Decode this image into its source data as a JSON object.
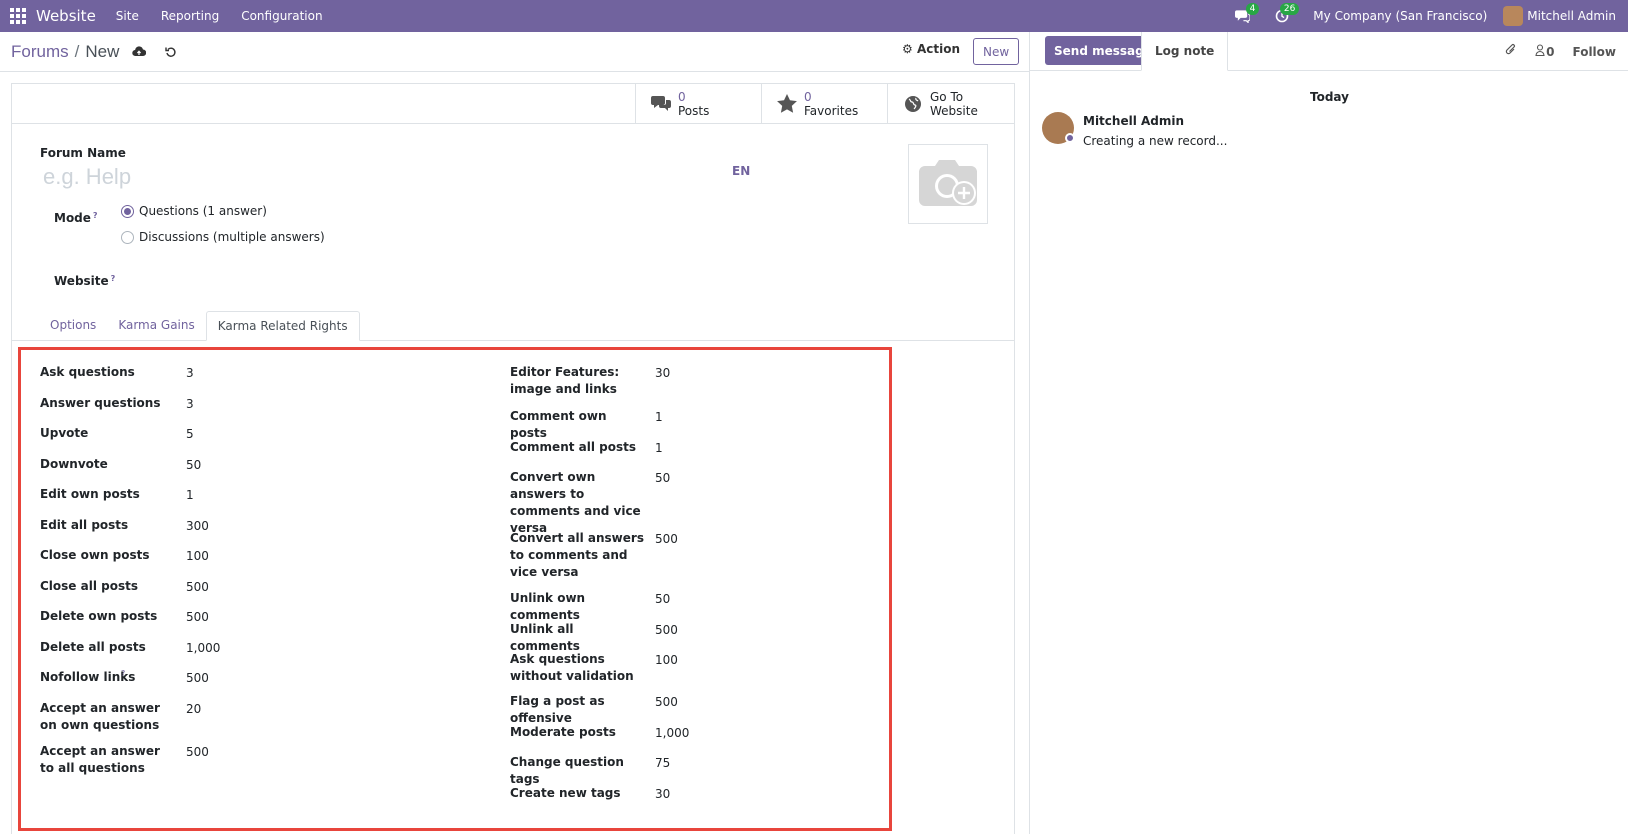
{
  "navbar": {
    "app_name": "Website",
    "menu": [
      "Site",
      "Reporting",
      "Configuration"
    ],
    "messages_badge": "4",
    "activities_badge": "26",
    "company": "My Company (San Francisco)",
    "user": "Mitchell Admin"
  },
  "control": {
    "breadcrumb_parent": "Forums",
    "breadcrumb_sep": "/",
    "breadcrumb_current": "New",
    "action_label": "Action",
    "new_label": "New"
  },
  "stats": [
    {
      "value": "0",
      "label": "Posts",
      "icon": "comments-icon"
    },
    {
      "value": "0",
      "label": "Favorites",
      "icon": "star-icon"
    },
    {
      "value": "Go To",
      "label": "Website",
      "icon": "globe-icon"
    }
  ],
  "form": {
    "forum_name_label": "Forum Name",
    "forum_name_placeholder": "e.g. Help",
    "lang": "EN",
    "mode_label": "Mode",
    "mode_help": "?",
    "mode_options": [
      "Questions (1 answer)",
      "Discussions (multiple answers)"
    ],
    "mode_selected": 0,
    "website_label": "Website",
    "website_help": "?"
  },
  "tabs": [
    "Options",
    "Karma Gains",
    "Karma Related Rights"
  ],
  "active_tab": 2,
  "karma_left": [
    {
      "label": "Ask questions",
      "value": "3"
    },
    {
      "label": "Answer questions",
      "value": "3"
    },
    {
      "label": "Upvote",
      "value": "5"
    },
    {
      "label": "Downvote",
      "value": "50"
    },
    {
      "label": "Edit own posts",
      "value": "1"
    },
    {
      "label": "Edit all posts",
      "value": "300"
    },
    {
      "label": "Close own posts",
      "value": "100"
    },
    {
      "label": "Close all posts",
      "value": "500"
    },
    {
      "label": "Delete own posts",
      "value": "500"
    },
    {
      "label": "Delete all posts",
      "value": "1,000"
    },
    {
      "label": "Nofollow links",
      "value": "500",
      "help": "?"
    },
    {
      "label": "Accept an answer on own questions",
      "value": "20"
    },
    {
      "label": "Accept an answer to all questions",
      "value": "500"
    }
  ],
  "karma_right": [
    {
      "label": "Editor Features: image and links",
      "value": "30"
    },
    {
      "label": "Comment own posts",
      "value": "1"
    },
    {
      "label": "Comment all posts",
      "value": "1"
    },
    {
      "label": "Convert own answers to comments and vice versa",
      "value": "50"
    },
    {
      "label": "Convert all answers to comments and vice versa",
      "value": "500"
    },
    {
      "label": "Unlink own comments",
      "value": "50"
    },
    {
      "label": "Unlink all comments",
      "value": "500"
    },
    {
      "label": "Ask questions without validation",
      "value": "100"
    },
    {
      "label": "Flag a post as offensive",
      "value": "500"
    },
    {
      "label": "Moderate posts",
      "value": "1,000"
    },
    {
      "label": "Change question tags",
      "value": "75"
    },
    {
      "label": "Create new tags",
      "value": "30"
    }
  ],
  "chatter": {
    "send_message": "Send message",
    "log_note": "Log note",
    "followers_count": "0",
    "follow_label": "Follow",
    "date_separator": "Today",
    "message_author": "Mitchell Admin",
    "message_body": "Creating a new record..."
  },
  "colors": {
    "brand": "#71639e",
    "highlight_border": "#e8453c",
    "badge": "#28a745"
  }
}
